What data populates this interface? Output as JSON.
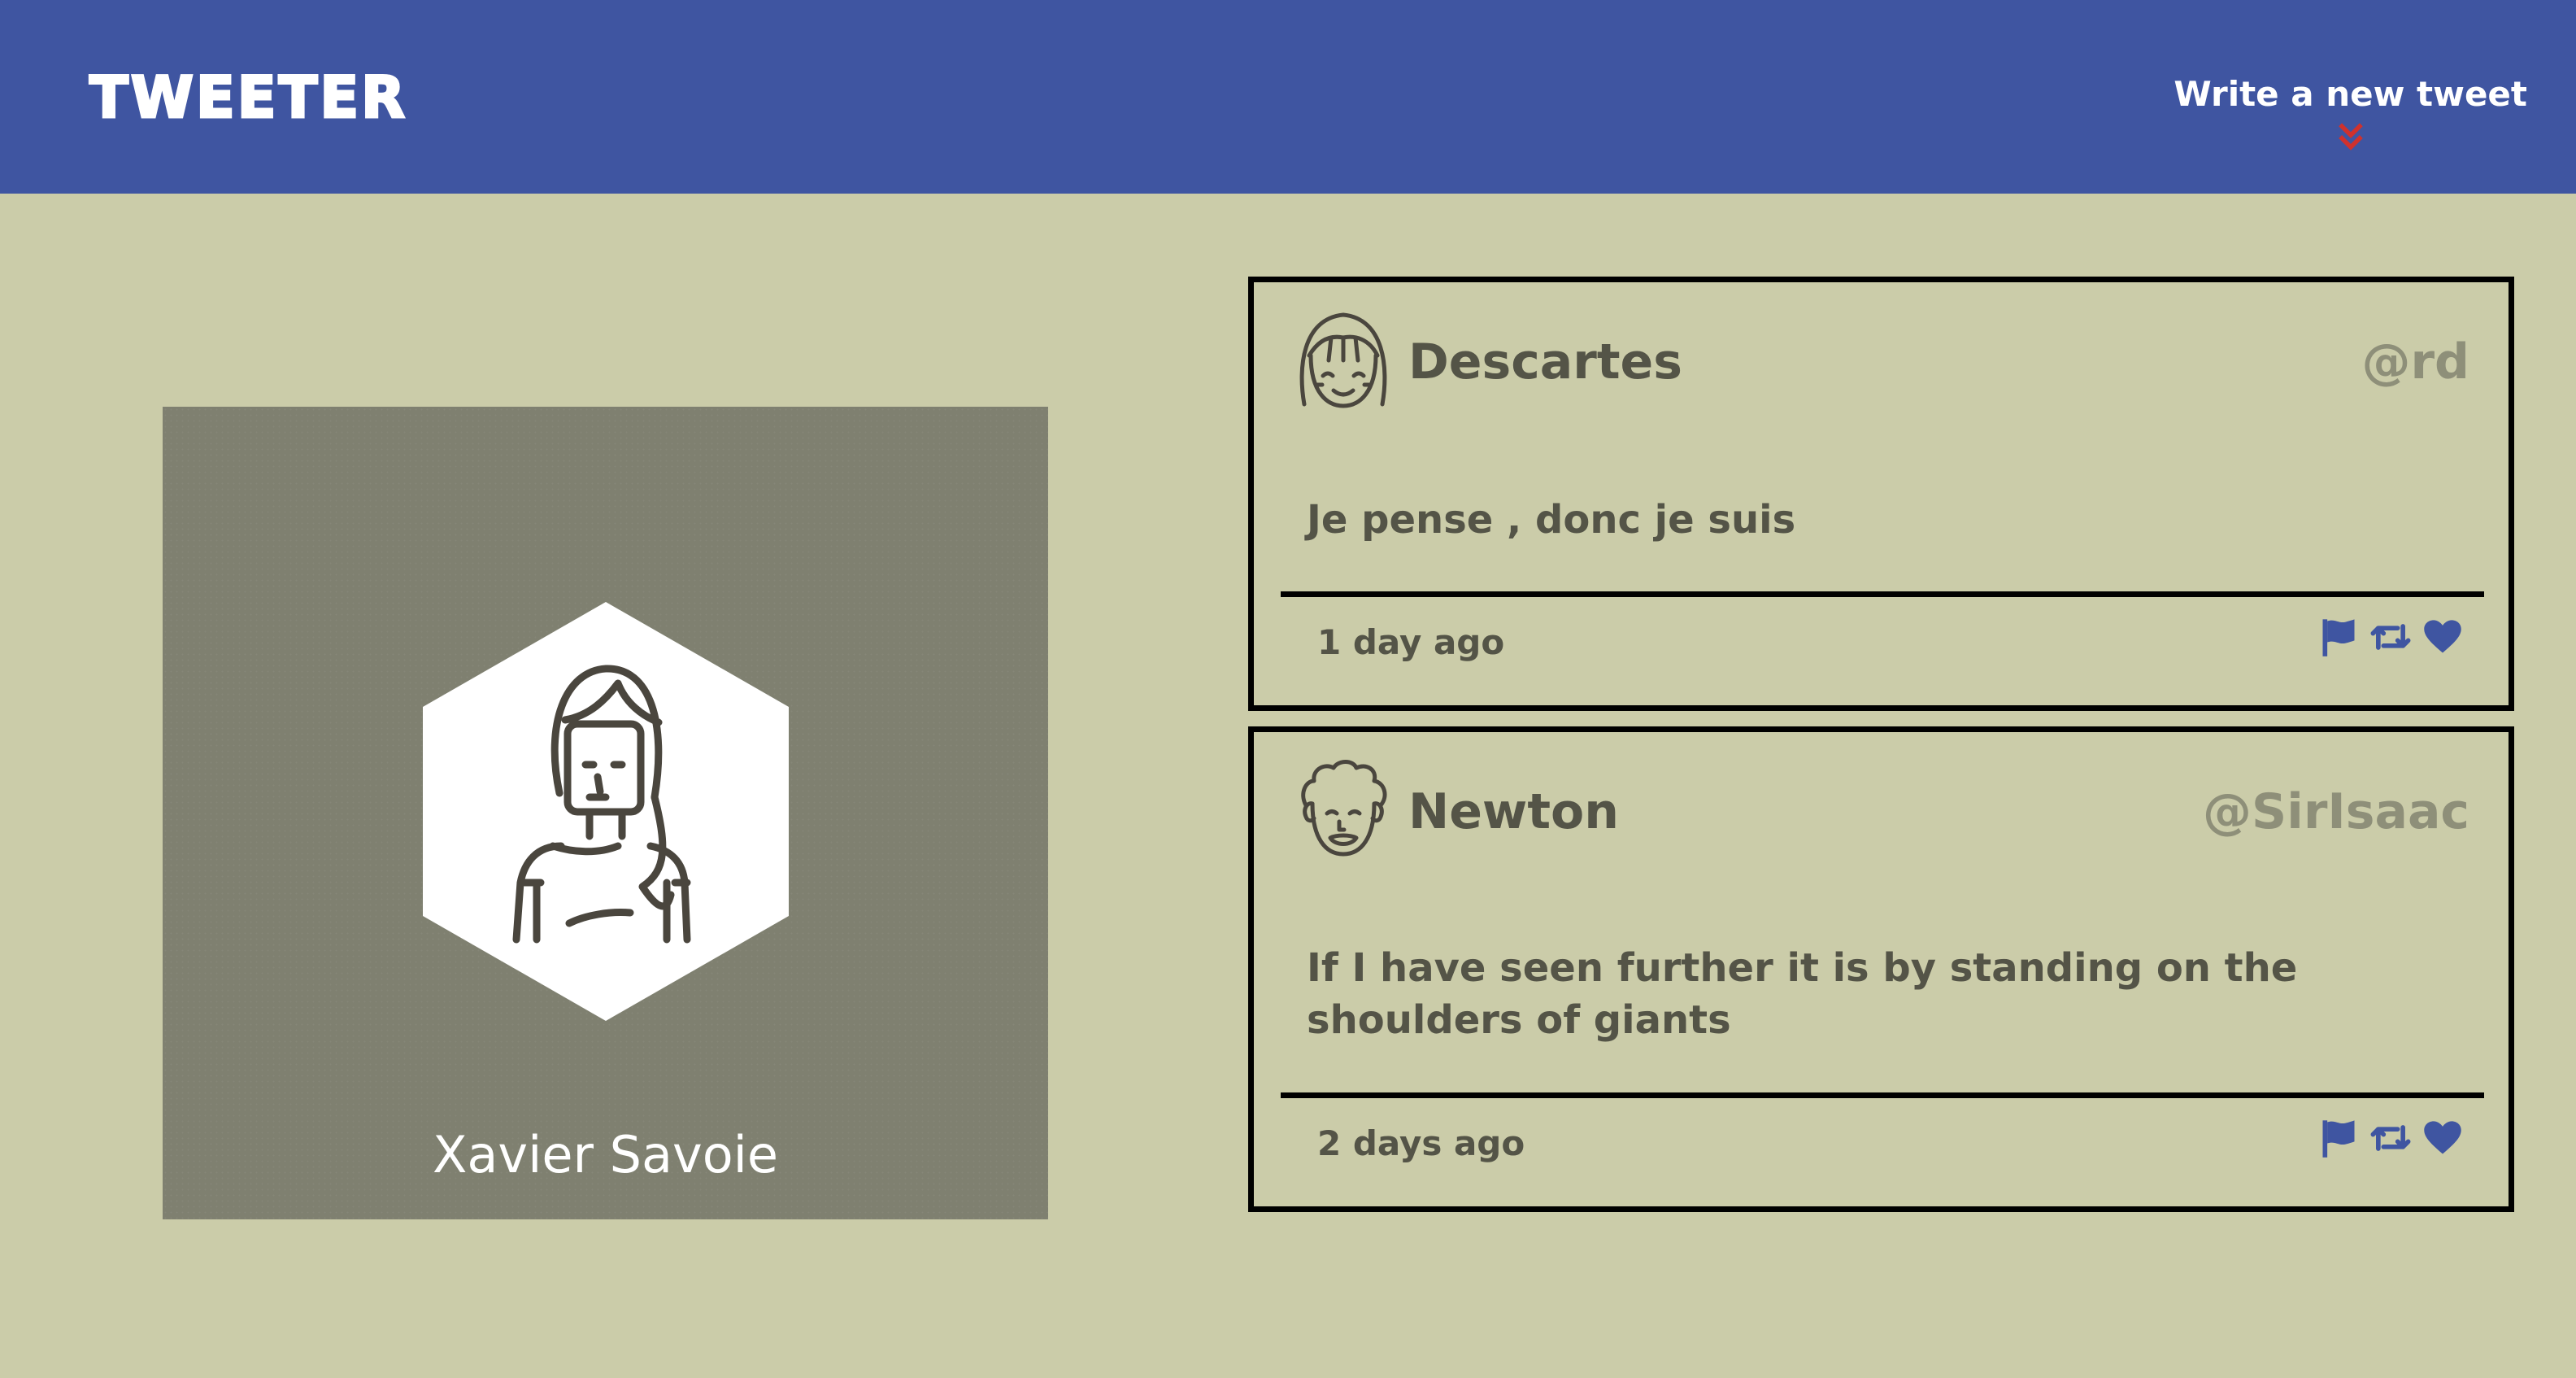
{
  "header": {
    "brand": "TWEETER",
    "compose_label": "Write a new tweet",
    "compose_icon": "double-chevron-down-icon"
  },
  "profile": {
    "name": "Xavier Savoie",
    "avatar_icon": "user-avatar-icon"
  },
  "tweets": [
    {
      "name": "Descartes",
      "handle": "@rd",
      "text": "Je pense , donc je suis",
      "time": "1 day ago",
      "avatar_icon": "girl-avatar-icon"
    },
    {
      "name": "Newton",
      "handle": "@SirIsaac",
      "text": "If I have seen further it is by standing on the shoulders of giants",
      "time": "2 days ago",
      "avatar_icon": "curly-hair-avatar-icon"
    }
  ],
  "actions": [
    "flag-icon",
    "retweet-icon",
    "heart-icon"
  ],
  "colors": {
    "navbar": "#3f55a1",
    "background": "#cbcca9",
    "profile_card": "#7f8070",
    "accent_arrow": "#d0312d",
    "action_icons": "#3f55a1",
    "text": "#545447",
    "handle": "#8e8f79"
  }
}
